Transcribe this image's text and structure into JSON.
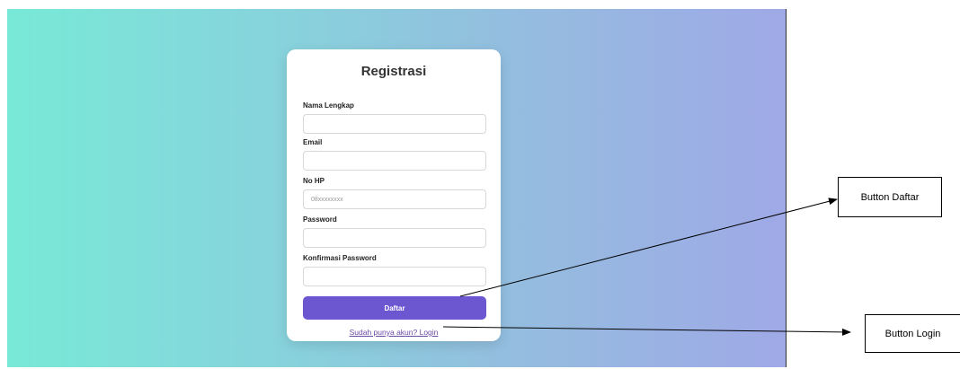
{
  "form": {
    "title": "Registrasi",
    "fields": [
      {
        "label": "Nama Lengkap",
        "value": "",
        "placeholder": ""
      },
      {
        "label": "Email",
        "value": "",
        "placeholder": ""
      },
      {
        "label": "No HP",
        "value": "",
        "placeholder": "08xxxxxxxx"
      },
      {
        "label": "Password",
        "value": "",
        "placeholder": ""
      },
      {
        "label": "Konfirmasi Password",
        "value": "",
        "placeholder": ""
      }
    ],
    "submit_label": "Daftar",
    "login_link": "Sudah punya akun? Login"
  },
  "annotations": {
    "button_daftar": "Button Daftar",
    "button_login": "Button Login"
  },
  "colors": {
    "background_start": "#78e9d7",
    "background_end": "#9fa9e6",
    "button": "#6c57d0",
    "link": "#6a4aa5"
  }
}
